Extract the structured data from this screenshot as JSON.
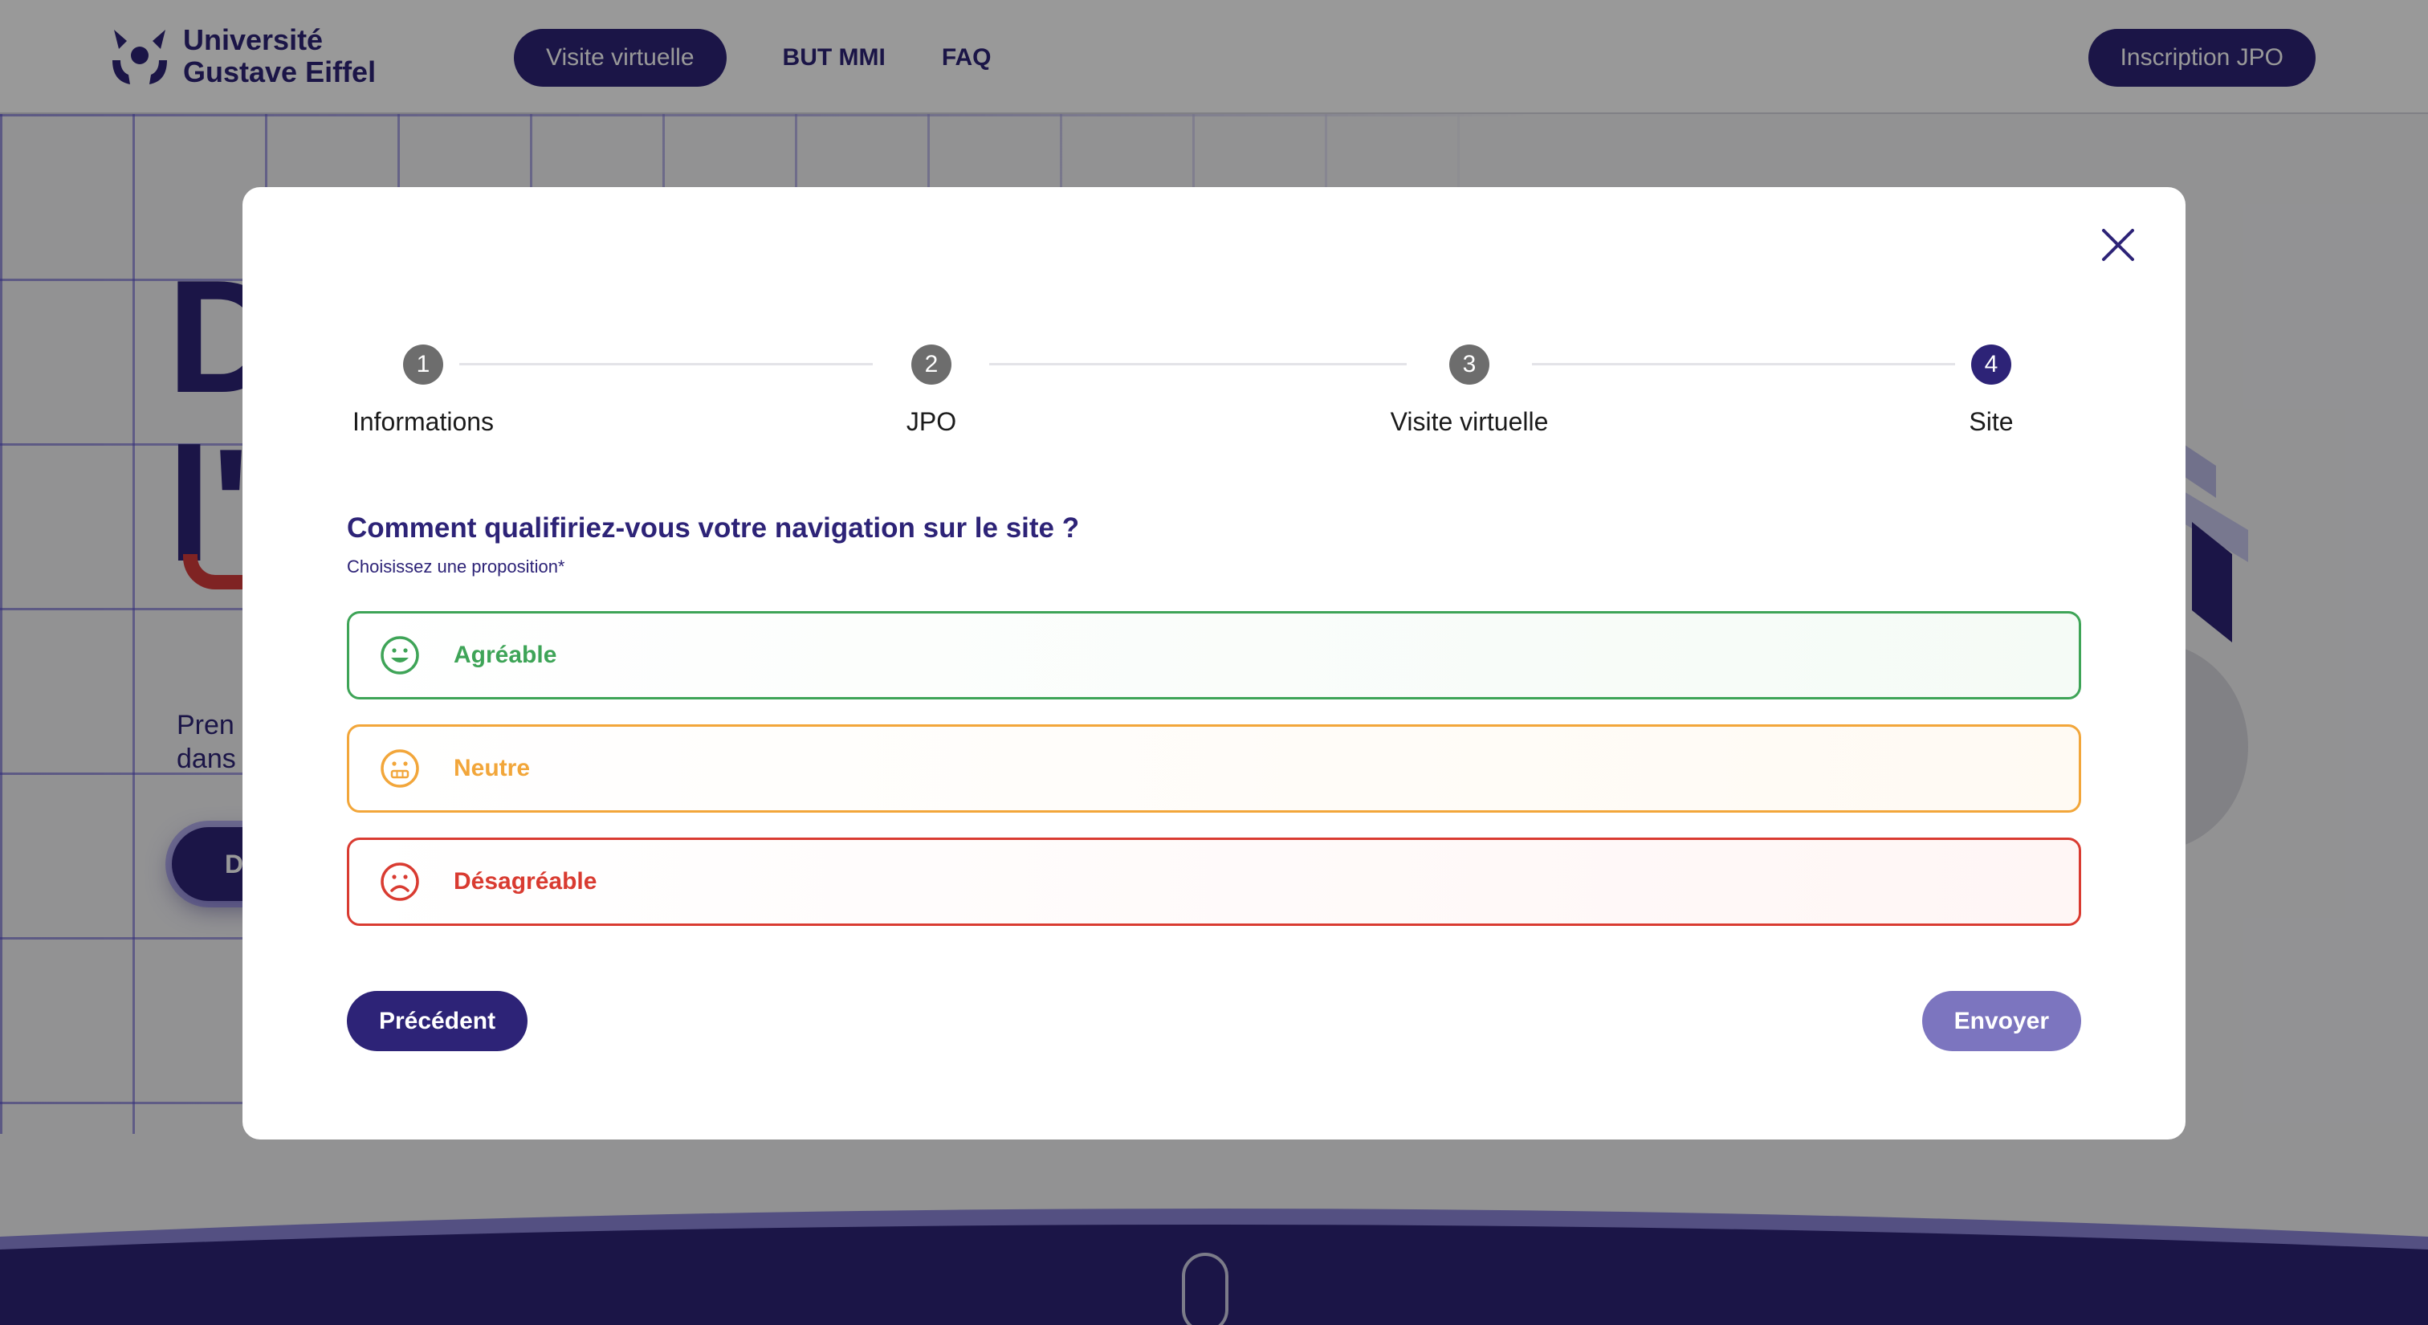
{
  "header": {
    "logo_line1": "Université",
    "logo_line2": "Gustave Eiffel",
    "nav": [
      "Visite virtuelle",
      "BUT MMI",
      "FAQ"
    ],
    "cta": "Inscription JPO"
  },
  "hero": {
    "title_fragment_1": "D",
    "title_fragment_2": "l'",
    "text_line1": "Pren",
    "text_line2": "dans",
    "button_fragment": "D"
  },
  "modal": {
    "close_icon": "close-icon",
    "steps": [
      {
        "number": "1",
        "label": "Informations",
        "active": false
      },
      {
        "number": "2",
        "label": "JPO",
        "active": false
      },
      {
        "number": "3",
        "label": "Visite virtuelle",
        "active": false
      },
      {
        "number": "4",
        "label": "Site",
        "active": true
      }
    ],
    "question": "Comment qualifiriez-vous votre navigation sur le site ?",
    "hint": "Choisissez une proposition*",
    "options": [
      {
        "label": "Agréable",
        "icon": "smiling-face-icon",
        "color": "#3ea457"
      },
      {
        "label": "Neutre",
        "icon": "neutral-face-icon",
        "color": "#f2a63a"
      },
      {
        "label": "Désagréable",
        "icon": "sad-face-icon",
        "color": "#d93b31"
      }
    ],
    "previous_label": "Précédent",
    "submit_label": "Envoyer"
  },
  "colors": {
    "brand": "#2d2377",
    "submit_disabled": "#7c75bf",
    "overlay": "rgba(0,0,0,0.40)"
  }
}
